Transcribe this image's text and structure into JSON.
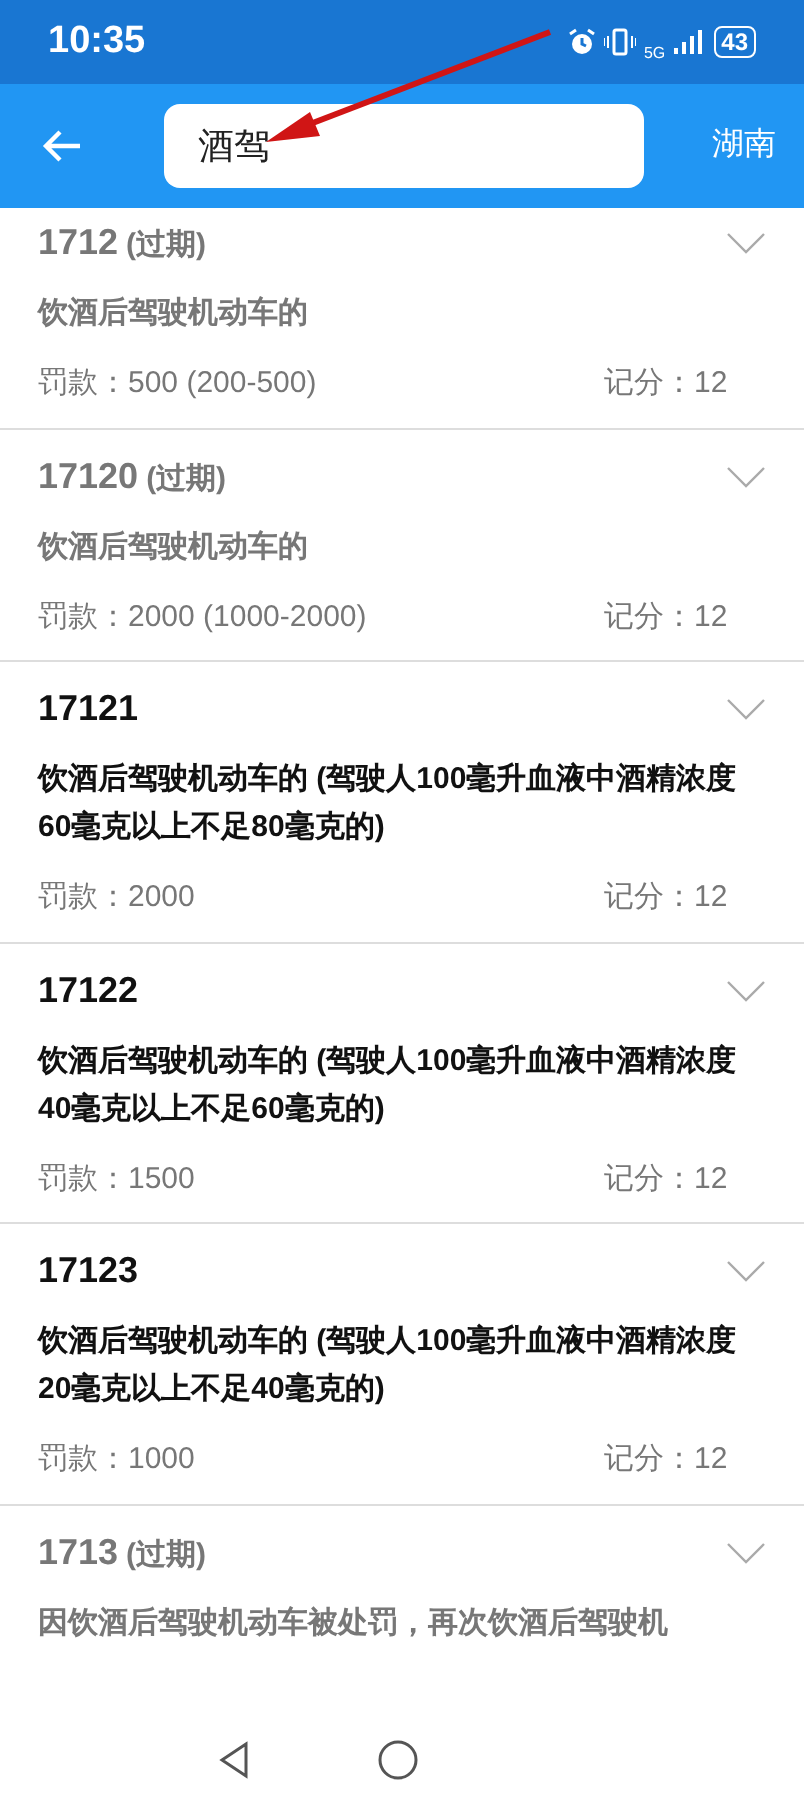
{
  "status_bar": {
    "time": "10:35",
    "network": "5G",
    "battery": "43"
  },
  "toolbar": {
    "search": {
      "value": "酒驾"
    },
    "region": "湖南"
  },
  "items": [
    {
      "code": "1712",
      "tag": "(过期)",
      "expired": true,
      "description": "饮酒后驾驶机动车的",
      "fine": "罚款：500 (200-500)",
      "points": "记分：12"
    },
    {
      "code": "17120",
      "tag": "(过期)",
      "expired": true,
      "description": "饮酒后驾驶机动车的",
      "fine": "罚款：2000 (1000-2000)",
      "points": "记分：12"
    },
    {
      "code": "17121",
      "expired": false,
      "description": "饮酒后驾驶机动车的 (驾驶人100毫升血液中酒精浓度60毫克以上不足80毫克的)",
      "fine": "罚款：2000",
      "points": "记分：12"
    },
    {
      "code": "17122",
      "expired": false,
      "description": "饮酒后驾驶机动车的 (驾驶人100毫升血液中酒精浓度40毫克以上不足60毫克的)",
      "fine": "罚款：1500",
      "points": "记分：12"
    },
    {
      "code": "17123",
      "expired": false,
      "description": "饮酒后驾驶机动车的 (驾驶人100毫升血液中酒精浓度20毫克以上不足40毫克的)",
      "fine": "罚款：1000",
      "points": "记分：12"
    },
    {
      "code": "1713",
      "tag": "(过期)",
      "expired": true,
      "description": "因饮酒后驾驶机动车被处罚，再次饮酒后驾驶机"
    }
  ]
}
